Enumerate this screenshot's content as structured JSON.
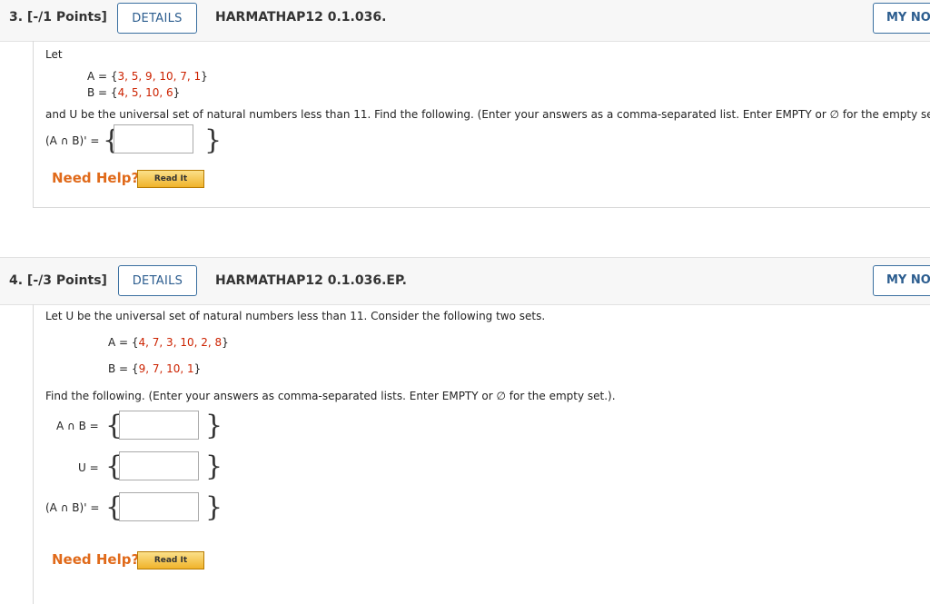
{
  "q3": {
    "number": "3. [-/1 Points]",
    "details_label": "DETAILS",
    "code": "HARMATHAP12 0.1.036.",
    "my_notes_label": "MY NO",
    "let_label": "Let",
    "setA_prefix": "A = {",
    "setA_values": "3, 5, 9, 10, 7, 1",
    "setA_suffix": "}",
    "setB_prefix": "B = {",
    "setB_values": "4, 5, 10, 6",
    "setB_suffix": "}",
    "instructions": "and U be the universal set of natural numbers less than 11. Find the following. (Enter your answers as a comma-separated list. Enter EMPTY or ∅ for the empty set.)",
    "expr1_label": "(A ∩ B)' =",
    "need_help": "Need Help?",
    "read_it": "Read It"
  },
  "q4": {
    "number": "4. [-/3 Points]",
    "details_label": "DETAILS",
    "code": "HARMATHAP12 0.1.036.EP.",
    "my_notes_label": "MY NO",
    "intro": "Let U be the universal set of natural numbers less than 11. Consider the following two sets.",
    "setA_prefix": "A = {",
    "setA_values": "4, 7, 3, 10, 2, 8",
    "setA_suffix": "}",
    "setB_prefix": "B = {",
    "setB_values": "9, 7, 10, 1",
    "setB_suffix": "}",
    "instructions": "Find the following. (Enter your answers as comma-separated lists. Enter EMPTY or ∅ for the empty set.).",
    "expr1_label": "A ∩ B  =",
    "expr2_label": "U  =",
    "expr3_label": "(A ∩ B)'  =",
    "need_help": "Need Help?",
    "read_it": "Read It"
  }
}
